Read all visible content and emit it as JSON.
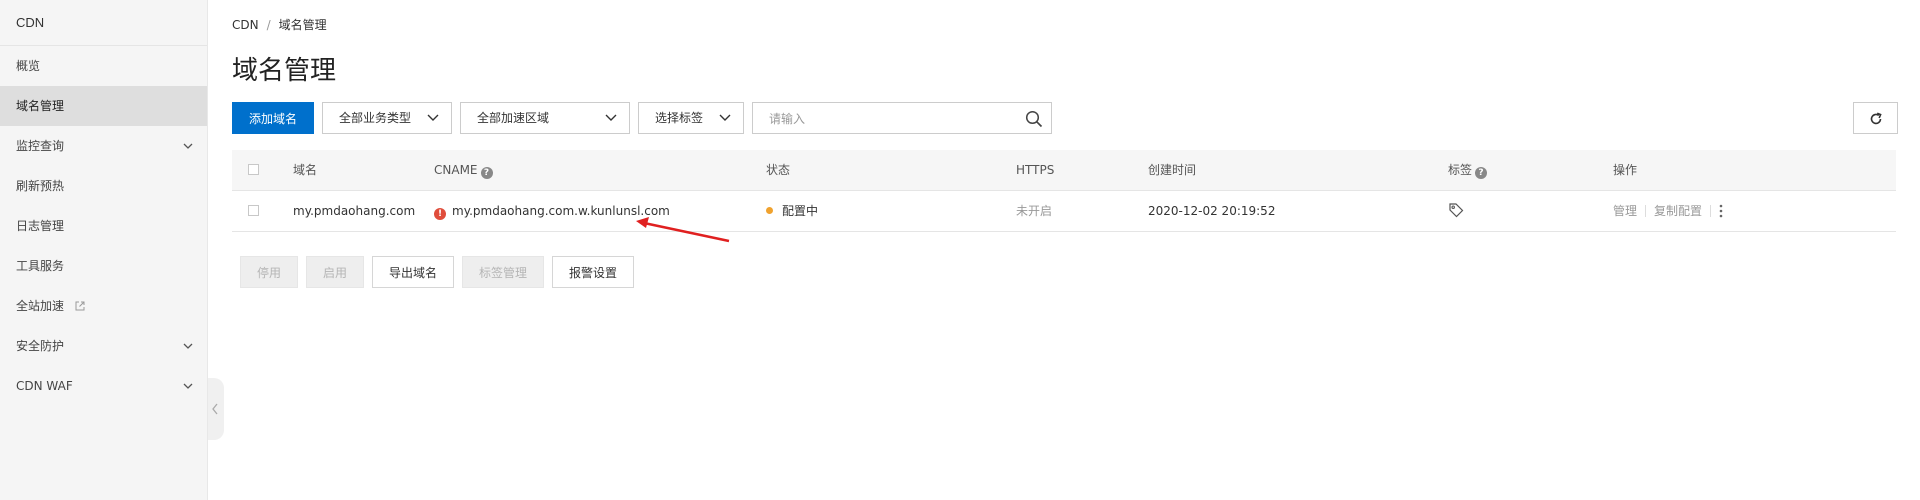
{
  "sidebar": {
    "title": "CDN",
    "items": [
      {
        "label": "概览"
      },
      {
        "label": "域名管理",
        "active": true
      },
      {
        "label": "监控查询",
        "expandable": true
      },
      {
        "label": "刷新预热"
      },
      {
        "label": "日志管理"
      },
      {
        "label": "工具服务"
      },
      {
        "label": "全站加速",
        "external": true
      },
      {
        "label": "安全防护",
        "expandable": true
      },
      {
        "label": "CDN WAF",
        "expandable": true
      }
    ]
  },
  "breadcrumb": {
    "root": "CDN",
    "separator": "/",
    "current": "域名管理"
  },
  "page_title": "域名管理",
  "toolbar": {
    "add_label": "添加域名",
    "business_type": "全部业务类型",
    "region": "全部加速区域",
    "tag_select": "选择标签",
    "search_placeholder": "请输入"
  },
  "table": {
    "columns": {
      "domain": "域名",
      "cname": "CNAME",
      "status": "状态",
      "https": "HTTPS",
      "created": "创建时间",
      "tags": "标签",
      "ops": "操作"
    },
    "rows": [
      {
        "domain": "my.pmdaohang.com",
        "cname": "my.pmdaohang.com.w.kunlunsl.com",
        "status": "配置中",
        "https": "未开启",
        "created": "2020-12-02 20:19:52",
        "op_manage": "管理",
        "op_copy": "复制配置"
      }
    ]
  },
  "actions": {
    "disable": "停用",
    "enable": "启用",
    "export": "导出域名",
    "tag_manage": "标签管理",
    "alarm": "报警设置"
  },
  "colors": {
    "primary": "#0070cc",
    "status_configuring": "#f0a22e",
    "warning": "#e04d3b",
    "annotation_arrow": "#e02020"
  }
}
